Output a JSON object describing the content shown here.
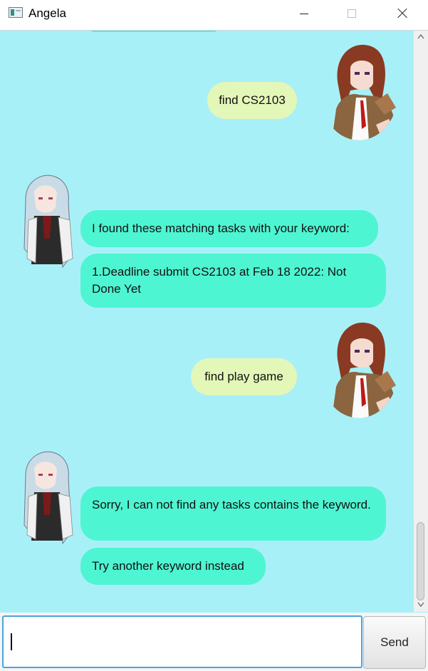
{
  "window": {
    "title": "Angela"
  },
  "chat": {
    "messages": [
      {
        "sender": "user",
        "text": "find CS2103"
      },
      {
        "sender": "bot",
        "text": "I found these matching tasks with your keyword:"
      },
      {
        "sender": "bot",
        "text": "1.Deadline submit CS2103 at Feb 18 2022: Not Done Yet"
      },
      {
        "sender": "user",
        "text": "find play game"
      },
      {
        "sender": "bot",
        "text": "Sorry, I can not find any tasks contains the keyword."
      },
      {
        "sender": "bot",
        "text": "Try another keyword instead"
      }
    ]
  },
  "input": {
    "value": "",
    "placeholder": ""
  },
  "send": {
    "label": "Send"
  },
  "colors": {
    "chat_background": "#a8f0f8",
    "user_bubble": "#e3f7b8",
    "bot_bubble": "#4ef5d2",
    "input_focus_border": "#4aa3df"
  },
  "icons": {
    "app": "app-window-icon",
    "minimize": "minimize-icon",
    "maximize": "maximize-icon",
    "close": "close-icon",
    "user_avatar": "user-avatar-red-haired-character",
    "bot_avatar": "bot-avatar-silver-haired-character"
  }
}
